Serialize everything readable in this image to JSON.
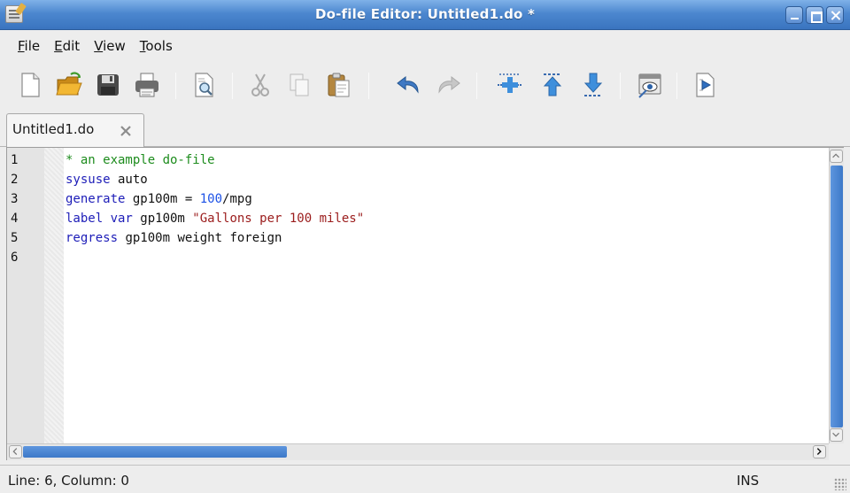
{
  "window": {
    "title": "Do-file Editor: Untitled1.do *"
  },
  "menu": {
    "file": {
      "acc": "F",
      "rest": "ile"
    },
    "edit": {
      "acc": "E",
      "rest": "dit"
    },
    "view": {
      "acc": "V",
      "rest": "iew"
    },
    "tools": {
      "acc": "T",
      "rest": "ools"
    }
  },
  "toolbar": {
    "icons": [
      "new-document-icon",
      "open-folder-icon",
      "save-icon",
      "print-icon",
      "find-icon",
      "cut-icon",
      "copy-icon",
      "paste-icon",
      "undo-icon",
      "redo-icon",
      "toggle-bookmark-icon",
      "previous-bookmark-icon",
      "next-bookmark-icon",
      "show-file-in-viewer-icon",
      "execute-do-icon"
    ]
  },
  "tabs": [
    {
      "label": "Untitled1.do"
    }
  ],
  "editor": {
    "line_numbers": [
      "1",
      "2",
      "3",
      "4",
      "5",
      "6"
    ],
    "lines": [
      {
        "tokens": [
          {
            "t": "cmt",
            "v": "* an example do-file"
          }
        ]
      },
      {
        "tokens": [
          {
            "t": "kw",
            "v": "sysuse"
          },
          {
            "t": "txt",
            "v": " auto"
          }
        ]
      },
      {
        "tokens": [
          {
            "t": "kw",
            "v": "generate"
          },
          {
            "t": "txt",
            "v": " gp100m = "
          },
          {
            "t": "num",
            "v": "100"
          },
          {
            "t": "txt",
            "v": "/mpg"
          }
        ]
      },
      {
        "tokens": [
          {
            "t": "kw",
            "v": "label var"
          },
          {
            "t": "txt",
            "v": " gp100m "
          },
          {
            "t": "str",
            "v": "\"Gallons per 100 miles\""
          }
        ]
      },
      {
        "tokens": [
          {
            "t": "kw",
            "v": "regress"
          },
          {
            "t": "txt",
            "v": " gp100m weight foreign"
          }
        ]
      },
      {
        "tokens": []
      }
    ]
  },
  "status": {
    "position": "Line: 6, Column: 0",
    "mode": "INS"
  },
  "colors": {
    "keyword": "#1d1db8",
    "comment": "#1d8c1d",
    "string": "#9b1c1c",
    "number": "#1d52e6",
    "titlebar": "#4c87cf"
  }
}
